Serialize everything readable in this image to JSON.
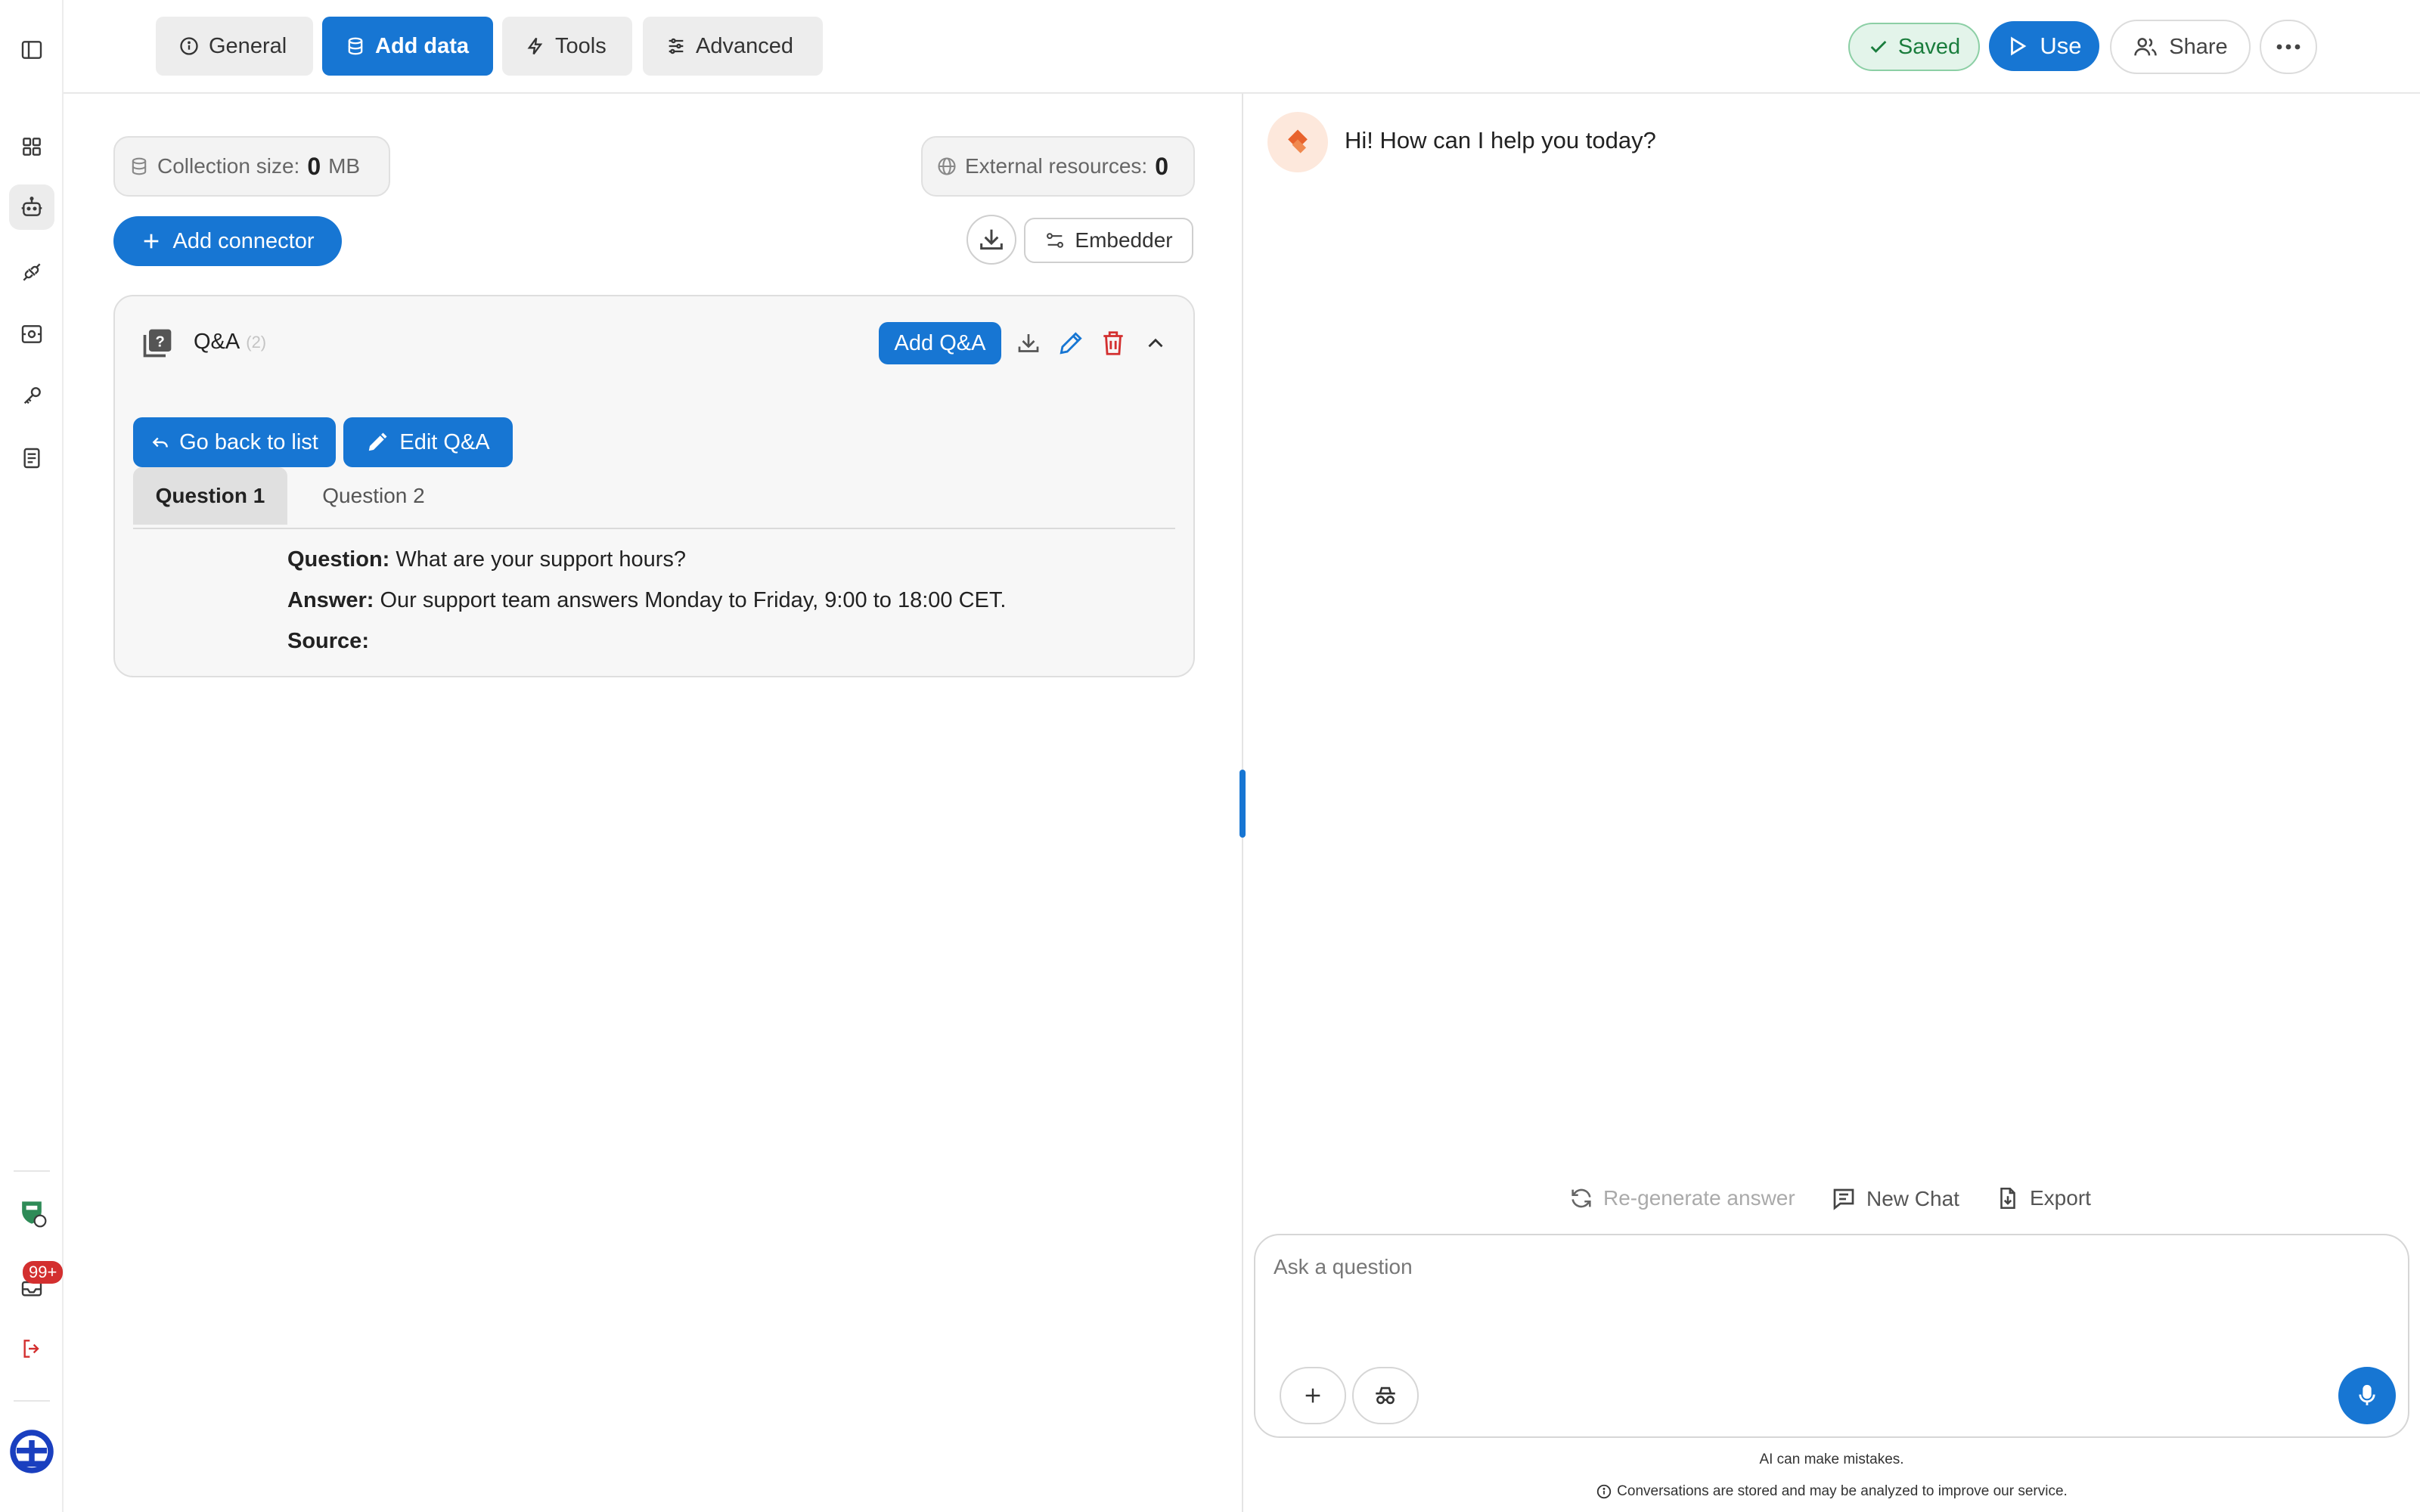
{
  "header": {
    "tabs": [
      {
        "label": "General",
        "icon": "info-icon",
        "active": false
      },
      {
        "label": "Add data",
        "icon": "database-icon",
        "active": true
      },
      {
        "label": "Tools",
        "icon": "bolt-icon",
        "active": false
      },
      {
        "label": "Advanced",
        "icon": "sliders-icon",
        "active": false
      }
    ],
    "saved_label": "Saved",
    "use_label": "Use",
    "share_label": "Share"
  },
  "rail": {
    "badge": "99+"
  },
  "data_panel": {
    "collection_size_label": "Collection size:",
    "collection_size_value": "0",
    "collection_size_unit": "MB",
    "external_resources_label": "External resources:",
    "external_resources_value": "0",
    "add_connector_label": "Add connector",
    "embedder_label": "Embedder"
  },
  "qa_card": {
    "title": "Q&A",
    "count": "(2)",
    "add_label": "Add Q&A",
    "go_back_label": "Go back to list",
    "edit_label": "Edit Q&A",
    "question_tabs": [
      "Question 1",
      "Question 2"
    ],
    "active_question_tab": 0,
    "question_key": "Question:",
    "question_value": " What are your support hours?",
    "answer_key": "Answer:",
    "answer_value": " Our support team answers Monday to Friday, 9:00 to 18:00 CET.",
    "source_key": "Source:",
    "source_value": ""
  },
  "chat": {
    "greeting": "Hi! How can I help you today?",
    "regenerate_label": "Re-generate answer",
    "new_chat_label": "New Chat",
    "export_label": "Export",
    "input_placeholder": "Ask a question",
    "disclaimer_1": "AI can make mistakes.",
    "disclaimer_2": "Conversations are stored and may be analyzed to improve our service."
  },
  "colors": {
    "accent": "#1776d3",
    "saved_green": "#1a7d3d",
    "delete_red": "#d32f2f",
    "bot_orange": "#e8622c"
  }
}
